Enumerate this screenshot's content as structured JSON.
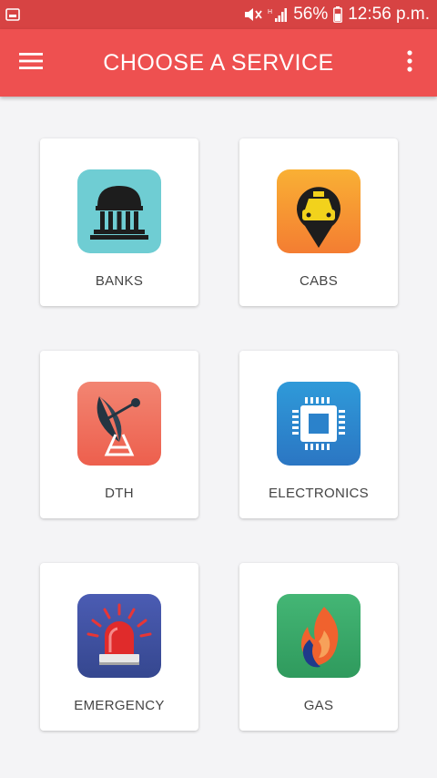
{
  "status_bar": {
    "battery": "56%",
    "time": "12:56 p.m.",
    "icons": [
      "gallery-icon",
      "mute-icon",
      "signal-icon",
      "battery-icon"
    ]
  },
  "app_bar": {
    "title": "CHOOSE A SERVICE",
    "menu_icon": "menu-icon",
    "more_icon": "more-vert-icon"
  },
  "services": [
    {
      "label": "BANKS",
      "icon": "bank-icon",
      "color": "#6fcdd3"
    },
    {
      "label": "CABS",
      "icon": "taxi-location-icon",
      "color": "#f7a43a"
    },
    {
      "label": "DTH",
      "icon": "satellite-dish-icon",
      "color": "#f0725f"
    },
    {
      "label": "ELECTRONICS",
      "icon": "chip-icon",
      "color": "#2f8cd3"
    },
    {
      "label": "EMERGENCY",
      "icon": "siren-icon",
      "color": "#4153a4"
    },
    {
      "label": "GAS",
      "icon": "flame-icon",
      "color": "#3ba56a"
    }
  ]
}
